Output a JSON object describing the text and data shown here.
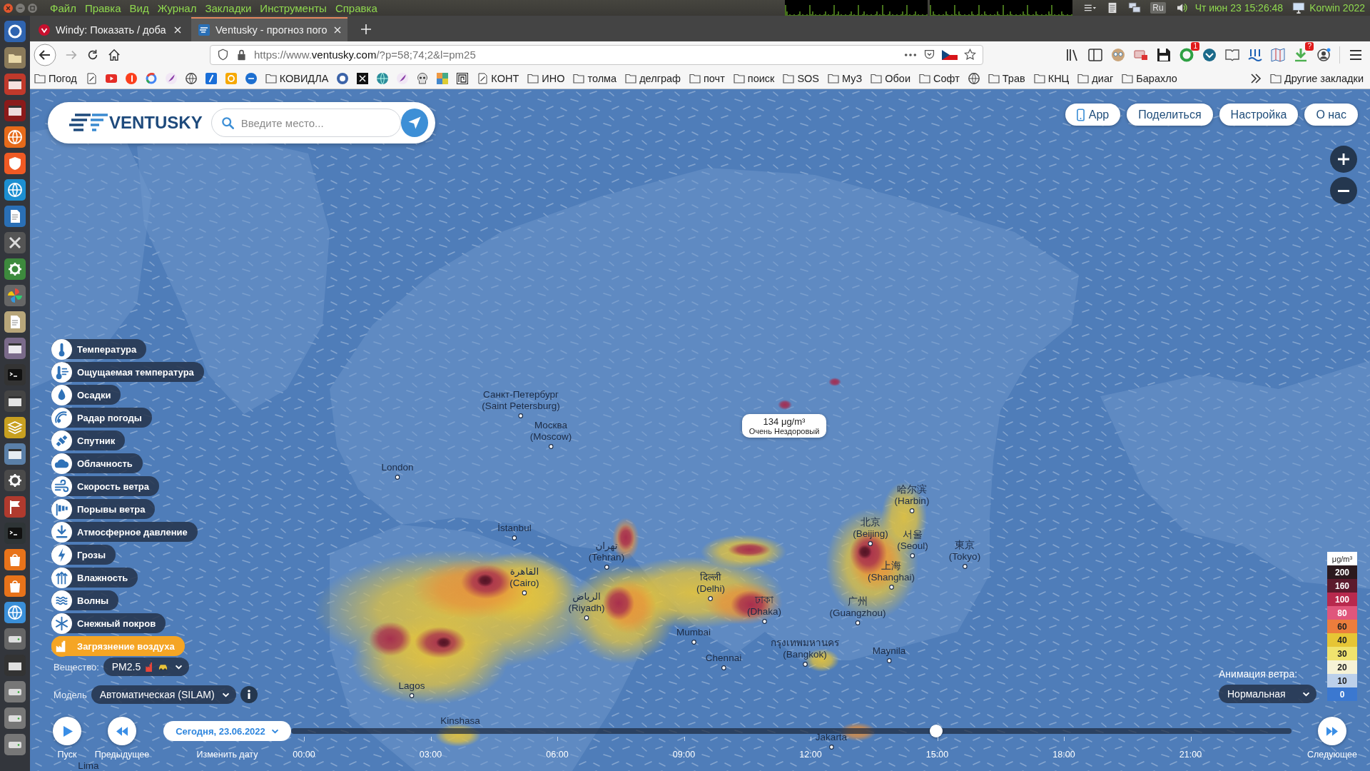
{
  "desktop_bar": {
    "menu": [
      "Файл",
      "Правка",
      "Вид",
      "Журнал",
      "Закладки",
      "Инструменты",
      "Справка"
    ],
    "keyboard_layout": "Ru",
    "clock": "Чт июн 23 15:26:48",
    "user": "Korwin 2022"
  },
  "browser": {
    "tabs": [
      {
        "title": "Windy: Показать / доба",
        "selected": false
      },
      {
        "title": "Ventusky - прогноз пого",
        "selected": true
      }
    ],
    "url": {
      "scheme": "https://www.",
      "host": "ventusky.com",
      "path": "/?p=58;74;2&l=pm25"
    },
    "toolbar_badges": [
      "1",
      "?"
    ],
    "bookmarks": [
      {
        "kind": "folder",
        "label": "Погод"
      },
      {
        "kind": "page"
      },
      {
        "kind": "icon"
      },
      {
        "kind": "icon"
      },
      {
        "kind": "icon"
      },
      {
        "kind": "icon"
      },
      {
        "kind": "icon"
      },
      {
        "kind": "icon"
      },
      {
        "kind": "icon"
      },
      {
        "kind": "icon"
      },
      {
        "kind": "folder",
        "label": "КОВИДЛА"
      },
      {
        "kind": "icon"
      },
      {
        "kind": "icon"
      },
      {
        "kind": "icon"
      },
      {
        "kind": "icon"
      },
      {
        "kind": "icon"
      },
      {
        "kind": "icon"
      },
      {
        "kind": "icon"
      },
      {
        "kind": "page",
        "label": "КОНТ"
      },
      {
        "kind": "folder",
        "label": "ИНО"
      },
      {
        "kind": "folder",
        "label": "толма"
      },
      {
        "kind": "folder",
        "label": "делграф"
      },
      {
        "kind": "folder",
        "label": "почт"
      },
      {
        "kind": "folder",
        "label": "поиск"
      },
      {
        "kind": "folder",
        "label": "SOS"
      },
      {
        "kind": "folder",
        "label": "МуЗ"
      },
      {
        "kind": "folder",
        "label": "Обои"
      },
      {
        "kind": "folder",
        "label": "Софт"
      },
      {
        "kind": "icon"
      },
      {
        "kind": "folder",
        "label": "Трав"
      },
      {
        "kind": "folder",
        "label": "КНЦ"
      },
      {
        "kind": "folder",
        "label": "диаг"
      },
      {
        "kind": "folder",
        "label": "Барахло"
      }
    ],
    "other_bookmarks": "Другие закладки"
  },
  "ventusky": {
    "logo": "VENTUSKY",
    "search": {
      "placeholder": "Введите место..."
    },
    "top_buttons": [
      "App",
      "Поделиться",
      "Настройка",
      "О нас"
    ],
    "layers": [
      {
        "label": "Температура",
        "selected": false
      },
      {
        "label": "Ощущаемая температура",
        "selected": false
      },
      {
        "label": "Осадки",
        "selected": false
      },
      {
        "label": "Радар погоды",
        "selected": false
      },
      {
        "label": "Спутник",
        "selected": false
      },
      {
        "label": "Облачность",
        "selected": false
      },
      {
        "label": "Скорость ветра",
        "selected": false
      },
      {
        "label": "Порывы ветра",
        "selected": false
      },
      {
        "label": "Атмосферное давление",
        "selected": false
      },
      {
        "label": "Грозы",
        "selected": false
      },
      {
        "label": "Влажность",
        "selected": false
      },
      {
        "label": "Волны",
        "selected": false
      },
      {
        "label": "Снежный покров",
        "selected": false
      },
      {
        "label": "Загрязнение воздуха",
        "selected": true
      }
    ],
    "substance": {
      "label": "Вещество:",
      "value": "PM2.5"
    },
    "model": {
      "label": "Модель",
      "value": "Автоматическая (SILAM)"
    },
    "cities": [
      {
        "name": "Санкт-Петербург",
        "alt": "(Saint Petersburg)"
      },
      {
        "name": "Москва",
        "alt": "(Moscow)"
      },
      {
        "name": "London"
      },
      {
        "name": "İstanbul"
      },
      {
        "name": "تهران",
        "alt": "(Tehran)"
      },
      {
        "name": "القاهرة",
        "alt": "(Cairo)"
      },
      {
        "name": "الرياض",
        "alt": "(Riyadh)"
      },
      {
        "name": "दिल्ली",
        "alt": "(Delhi)"
      },
      {
        "name": "ঢাকা",
        "alt": "(Dhaka)"
      },
      {
        "name": "Mumbai"
      },
      {
        "name": "Chennai"
      },
      {
        "name": "กรุงเทพมหานคร",
        "alt": "(Bangkok)"
      },
      {
        "name": "北京",
        "alt": "(Beijing)"
      },
      {
        "name": "서울",
        "alt": "(Seoul)"
      },
      {
        "name": "上海",
        "alt": "(Shanghai)"
      },
      {
        "name": "東京",
        "alt": "(Tokyo)"
      },
      {
        "name": "哈尔滨",
        "alt": "(Harbin)"
      },
      {
        "name": "广州",
        "alt": "(Guangzhou)"
      },
      {
        "name": "Maynila"
      },
      {
        "name": "Lagos"
      },
      {
        "name": "Kinshasa"
      },
      {
        "name": "Jakarta"
      },
      {
        "name": "Lima"
      }
    ],
    "tooltip": {
      "value": "134 μg/m³",
      "category": "Очень Нездоровый"
    },
    "legend": {
      "unit": "μg/m³",
      "steps": [
        {
          "value": "200",
          "color": "#2b1a1e"
        },
        {
          "value": "160",
          "color": "#5c1a2c"
        },
        {
          "value": "100",
          "color": "#b8294d"
        },
        {
          "value": "80",
          "color": "#e0567c"
        },
        {
          "value": "60",
          "color": "#ec7d3c"
        },
        {
          "value": "40",
          "color": "#e6c535"
        },
        {
          "value": "30",
          "color": "#f0e36e"
        },
        {
          "value": "20",
          "color": "#f6f2d6"
        },
        {
          "value": "10",
          "color": "#bcd0ea"
        },
        {
          "value": "0",
          "color": "#3b78d0"
        }
      ]
    },
    "wind_animation": {
      "label": "Анимация ветра:",
      "value": "Нормальная"
    },
    "playback": {
      "play": "Пуск",
      "previous": "Предыдущее",
      "date": "Сегодня, 23.06.2022",
      "change_date": "Изменить дату",
      "next": "Следующее"
    },
    "timeline": {
      "ticks": [
        "00:00",
        "03:00",
        "06:00",
        "09:00",
        "12:00",
        "15:00",
        "18:00",
        "21:00"
      ],
      "level": 0.645
    }
  }
}
